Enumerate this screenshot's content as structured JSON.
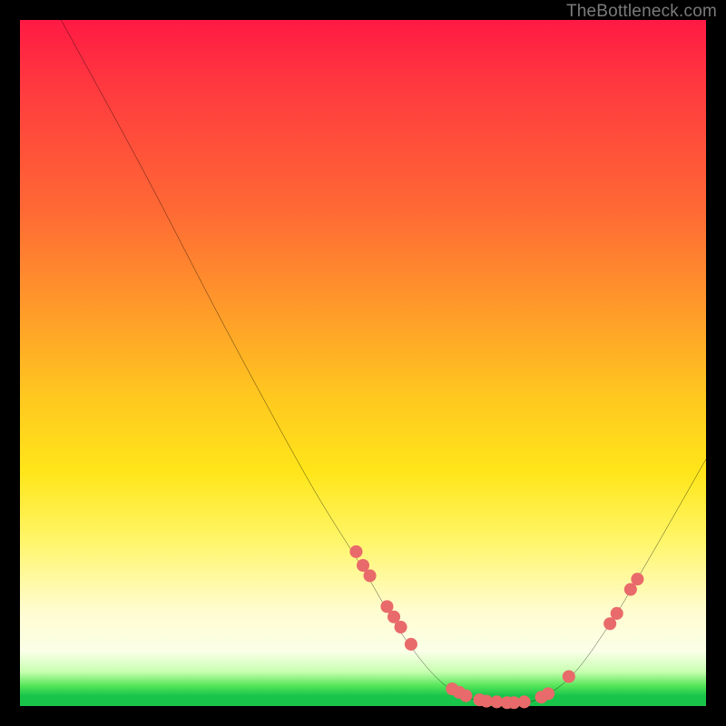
{
  "watermark": "TheBottleneck.com",
  "chart_data": {
    "type": "line",
    "title": "",
    "xlabel": "",
    "ylabel": "",
    "xlim": [
      0,
      100
    ],
    "ylim": [
      0,
      100
    ],
    "grid": false,
    "curve": {
      "name": "bottleneck-curve",
      "points": [
        {
          "x": 6,
          "y": 100
        },
        {
          "x": 18,
          "y": 78
        },
        {
          "x": 30,
          "y": 55
        },
        {
          "x": 42,
          "y": 33
        },
        {
          "x": 50,
          "y": 20
        },
        {
          "x": 56,
          "y": 10
        },
        {
          "x": 62,
          "y": 3
        },
        {
          "x": 68,
          "y": 0.5
        },
        {
          "x": 74,
          "y": 0.5
        },
        {
          "x": 80,
          "y": 4
        },
        {
          "x": 86,
          "y": 12
        },
        {
          "x": 92,
          "y": 22
        },
        {
          "x": 100,
          "y": 36
        }
      ]
    },
    "markers": {
      "name": "highlight-points",
      "color": "#e96a6a",
      "radius": 7,
      "xy": [
        [
          49,
          22.5
        ],
        [
          50,
          20.5
        ],
        [
          51,
          19
        ],
        [
          53.5,
          14.5
        ],
        [
          54.5,
          13
        ],
        [
          55.5,
          11.5
        ],
        [
          57,
          9
        ],
        [
          63,
          2.5
        ],
        [
          64,
          2
        ],
        [
          65,
          1.5
        ],
        [
          67,
          0.9
        ],
        [
          68,
          0.7
        ],
        [
          69.5,
          0.6
        ],
        [
          71,
          0.5
        ],
        [
          72,
          0.5
        ],
        [
          73.5,
          0.6
        ],
        [
          76,
          1.3
        ],
        [
          77,
          1.8
        ],
        [
          80,
          4.3
        ],
        [
          86,
          12
        ],
        [
          87,
          13.5
        ],
        [
          89,
          17
        ],
        [
          90,
          18.5
        ]
      ]
    }
  }
}
